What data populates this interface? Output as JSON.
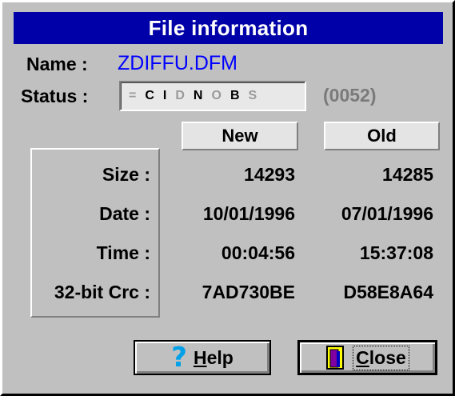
{
  "dialog": {
    "title": "File information",
    "name_label": "Name :",
    "name_value": "ZDIFFU.DFM",
    "status_label": "Status :",
    "status_flags": [
      "=",
      "C",
      "I",
      "D",
      "N",
      "O",
      "B",
      "S"
    ],
    "status_code": "(0052)"
  },
  "columns": {
    "new": "New",
    "old": "Old"
  },
  "rows": [
    {
      "label": "Size :",
      "new": "14293",
      "old": "14285"
    },
    {
      "label": "Date :",
      "new": "10/01/1996",
      "old": "07/01/1996"
    },
    {
      "label": "Time :",
      "new": "00:04:56",
      "old": "15:37:08"
    },
    {
      "label": "32-bit Crc :",
      "new": "7AD730BE",
      "old": "D58E8A64"
    }
  ],
  "buttons": {
    "help_accel": "H",
    "help_rest": "elp",
    "close_accel": "C",
    "close_rest": "lose"
  },
  "colors": {
    "titlebar": "#0000a8",
    "filename": "#0000ff",
    "face": "#c0c0c0"
  },
  "icons": {
    "help": "question-mark-icon",
    "close": "door-exit-icon"
  }
}
